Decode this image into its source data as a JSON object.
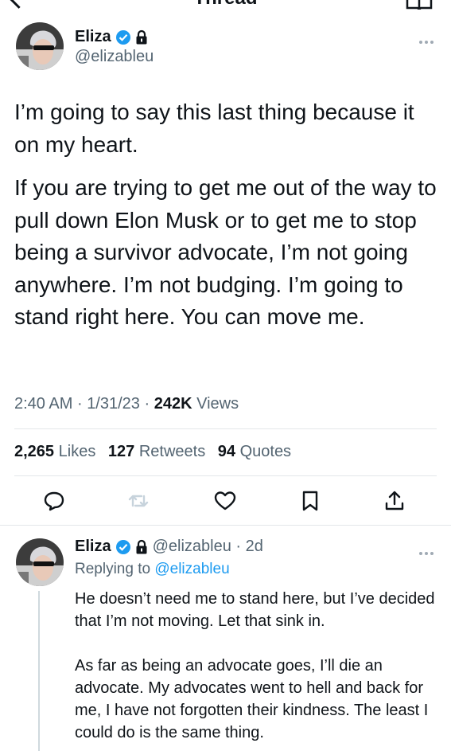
{
  "header": {
    "title": "Thread"
  },
  "tweet": {
    "name": "Eliza",
    "handle": "@elizableu",
    "paragraphs": [
      "I’m going to say this last thing because it on my heart.",
      "If you are trying to get me out of the way to pull down Elon Musk or to get me to stop being a survivor advocate, I’m not going anywhere. I’m not budging. I’m going to stand right here. You can move me."
    ],
    "time": "2:40 AM",
    "date": "1/31/23",
    "views_count": "242K",
    "views_label": "Views",
    "likes_count": "2,265",
    "likes_label": "Likes",
    "retweets_count": "127",
    "retweets_label": "Retweets",
    "quotes_count": "94",
    "quotes_label": "Quotes",
    "sep": "·"
  },
  "reply": {
    "name": "Eliza",
    "handle_time": "@elizableu · 2d",
    "replying_prefix": "Replying to",
    "replying_handle": "@elizableu",
    "paragraphs": [
      "He doesn’t need me to stand here, but I’ve decided that I’m not moving. Let that sink in.",
      "As far as being an advocate goes, I’ll die an advocate. My advocates went to hell and back for me, I have not forgotten their kindness. The least I could do is the same thing."
    ]
  },
  "colors": {
    "verified": "#1d9bf0",
    "text": "#0f1419",
    "muted": "#536471",
    "retweet_disabled": "#c7d3dc"
  },
  "icons": [
    "back-icon",
    "reader-icon",
    "verified-icon",
    "lock-icon",
    "more-icon",
    "reply-icon",
    "retweet-icon",
    "like-icon",
    "bookmark-icon",
    "share-icon"
  ]
}
